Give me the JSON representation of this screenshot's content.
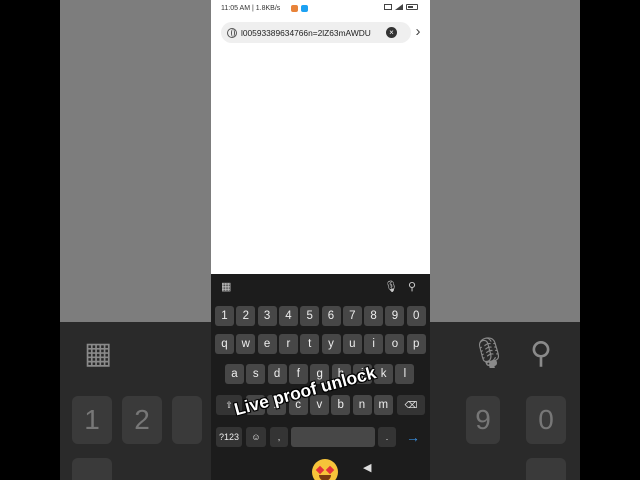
{
  "status": {
    "time": "11:05 AM | 1.8KB/s",
    "colors": {
      "app1": "#e8833a",
      "app2": "#1da1f2"
    }
  },
  "urlbar": {
    "value": "l00593389634766n=2lZ63mAWDU",
    "clear_icon": "clear-icon",
    "go_icon": "chevron-right-icon"
  },
  "keyboard": {
    "row_numbers": [
      "1",
      "2",
      "3",
      "4",
      "5",
      "6",
      "7",
      "8",
      "9",
      "0"
    ],
    "row_top": [
      "q",
      "w",
      "e",
      "r",
      "t",
      "y",
      "u",
      "i",
      "o",
      "p"
    ],
    "row_mid": [
      "a",
      "s",
      "d",
      "f",
      "g",
      "h",
      "j",
      "k",
      "l"
    ],
    "row_bot": [
      "z",
      "x",
      "c",
      "v",
      "b",
      "n",
      "m"
    ],
    "sym_label": "?123",
    "enter_icon": "arrow-right-icon"
  },
  "overlay": {
    "caption": "Live proof unlock"
  },
  "background": {
    "numbers_left": [
      "1",
      "2"
    ],
    "numbers_right": [
      "9",
      "0"
    ]
  }
}
